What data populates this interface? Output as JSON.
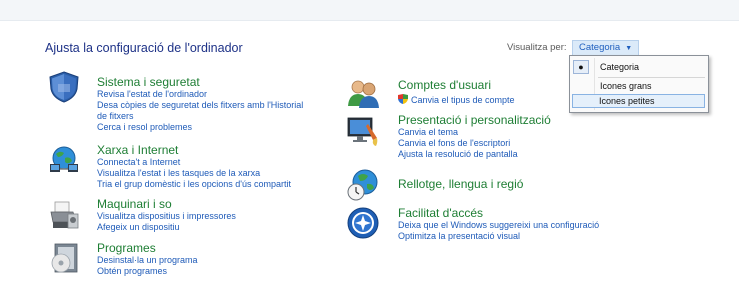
{
  "page_title": "Ajusta la configuració de l'ordinador",
  "view_by_label": "Visualitza per:",
  "view_by_value": "Categoria",
  "menu": {
    "items": [
      "Categoria",
      "Icones grans",
      "Icones petites"
    ],
    "checked": "Categoria",
    "highlighted": "Icones petites"
  },
  "categories": {
    "security": {
      "icon": "shield-icon",
      "title": "Sistema i seguretat",
      "links": [
        "Revisa l'estat de l'ordinador",
        "Desa còpies de seguretat dels fitxers amb l'Historial",
        "de fitxers",
        "Cerca i resol problemes"
      ]
    },
    "network": {
      "icon": "network-globe-icon",
      "title": "Xarxa i Internet",
      "links": [
        "Connecta't a Internet",
        "Visualitza l'estat i les tasques de la xarxa",
        "Tria el grup domèstic i les opcions d'ús compartit"
      ]
    },
    "hardware": {
      "icon": "printer-icon",
      "title": "Maquinari i so",
      "links": [
        "Visualitza dispositius i impressores",
        "Afegeix un dispositiu"
      ]
    },
    "programs": {
      "icon": "programs-icon",
      "title": "Programes",
      "links": [
        "Desinstal·la un programa",
        "Obtén programes"
      ]
    },
    "accounts": {
      "icon": "users-icon",
      "title": "Comptes d'usuari",
      "links": [
        "Canvia el tipus de compte"
      ]
    },
    "appearance": {
      "icon": "monitor-paint-icon",
      "title": "Presentació i personalització",
      "links": [
        "Canvia el tema",
        "Canvia el fons de l'escriptori",
        "Ajusta la resolució de pantalla"
      ]
    },
    "clock": {
      "icon": "clock-globe-icon",
      "title": "Rellotge, llengua i regió",
      "links": []
    },
    "ease": {
      "icon": "ease-of-access-icon",
      "title": "Facilitat d'accés",
      "links": [
        "Deixa que el Windows suggereixi una configuració",
        "Optimitza la presentació visual"
      ]
    }
  },
  "colors": {
    "title_green": "#1e7e34",
    "link_blue": "#1f5bb8",
    "heading_blue": "#1e3287"
  }
}
